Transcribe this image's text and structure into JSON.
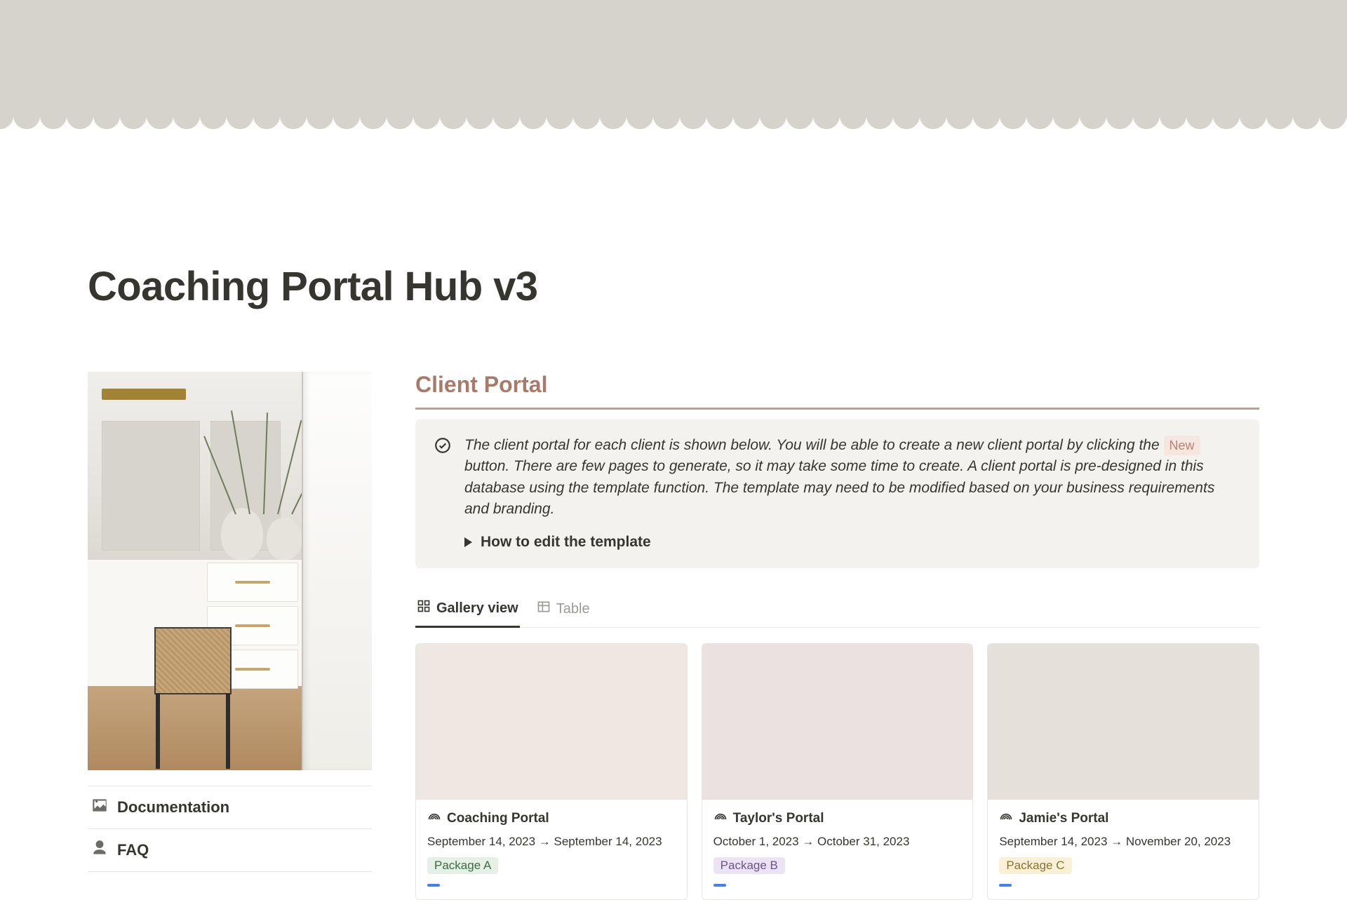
{
  "page": {
    "title": "Coaching Portal Hub v3"
  },
  "sidebar": {
    "links": [
      {
        "label": "Documentation"
      },
      {
        "label": "FAQ"
      }
    ]
  },
  "section": {
    "title": "Client Portal",
    "callout_pre": "The client portal for each client is shown below. You will be able to create a new client portal by clicking the ",
    "callout_tag": "New",
    "callout_post": " button. There are few pages to generate, so it may take some time to create. A client portal is pre-designed in this database using the template function. The template may need to be modified based on your business requirements and branding.",
    "toggle_label": "How to edit the template"
  },
  "views": {
    "gallery": "Gallery view",
    "table": "Table"
  },
  "cards": [
    {
      "title": "Coaching Portal",
      "dates": "September 14, 2023 → September 14, 2023",
      "package": "Package A",
      "package_class": "pkg-a",
      "cover_class": "cc1"
    },
    {
      "title": "Taylor's Portal",
      "dates": "October 1, 2023 → October 31, 2023",
      "package": "Package B",
      "package_class": "pkg-b",
      "cover_class": "cc2"
    },
    {
      "title": "Jamie's Portal",
      "dates": "September 14, 2023 → November 20, 2023",
      "package": "Package C",
      "package_class": "pkg-c",
      "cover_class": "cc3"
    }
  ]
}
